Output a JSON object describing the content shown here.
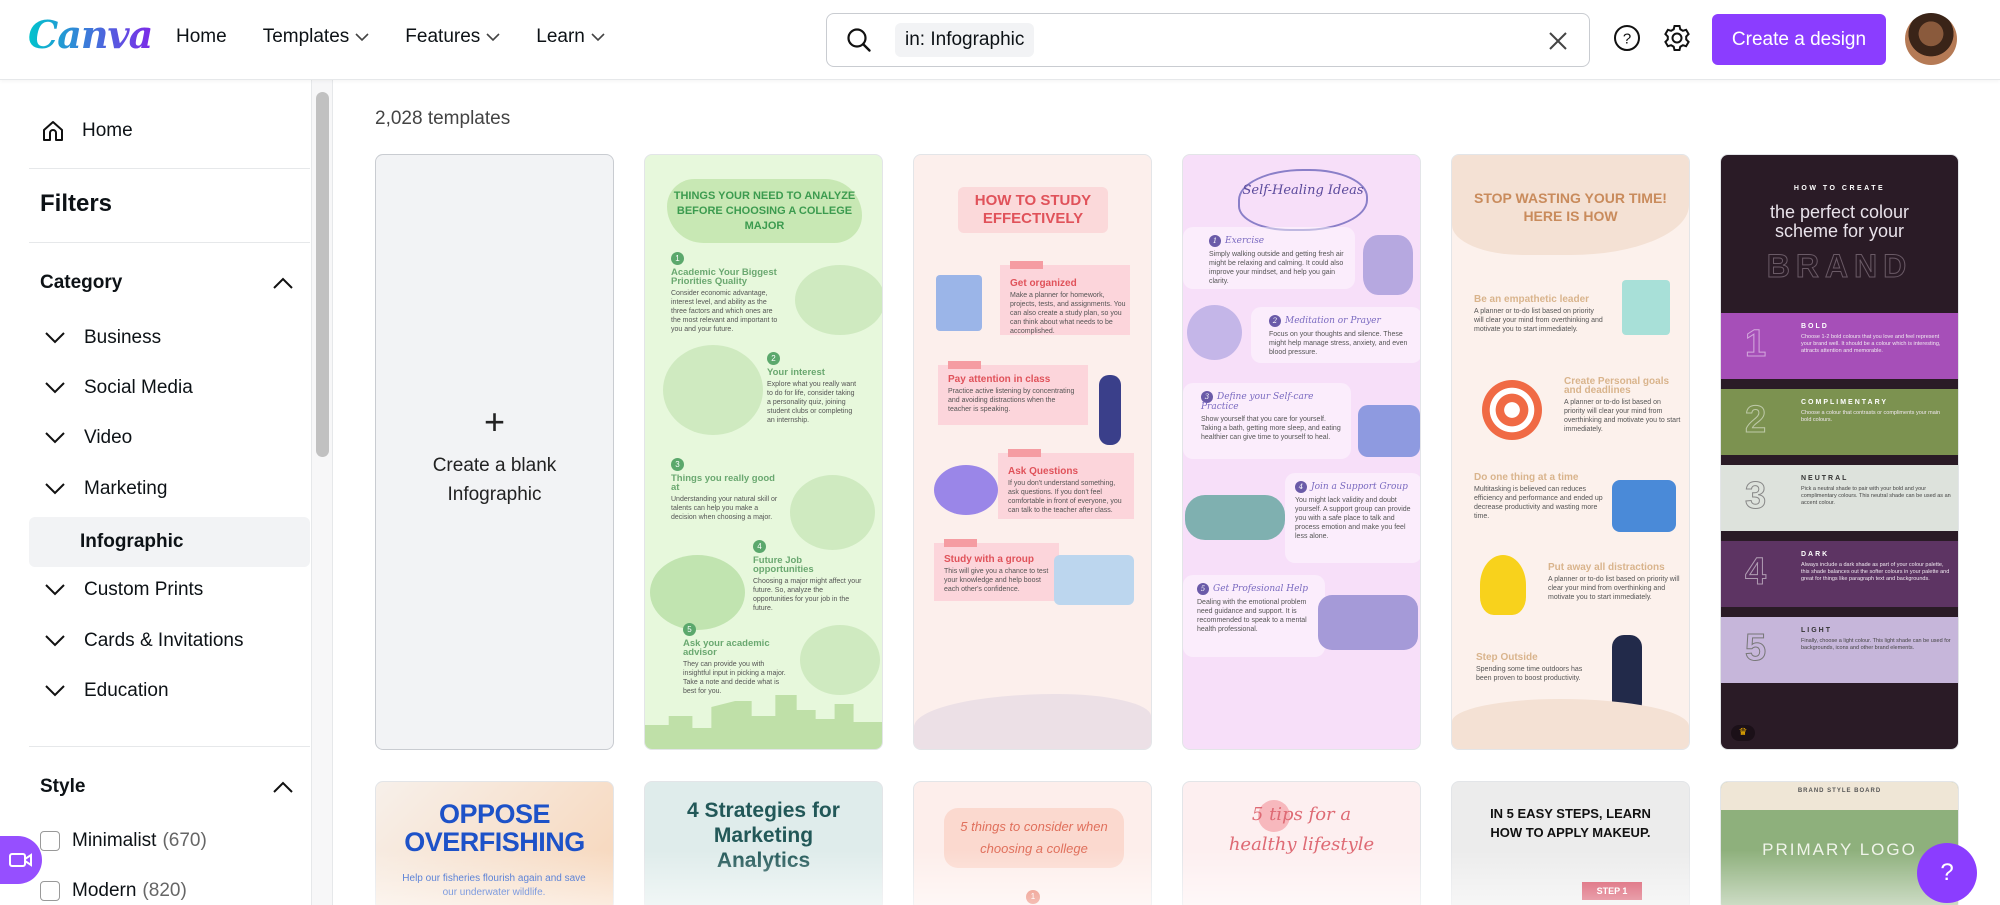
{
  "app": {
    "name": "Canva"
  },
  "header": {
    "logo": "Canva",
    "nav": [
      {
        "label": "Home",
        "has_dropdown": false
      },
      {
        "label": "Templates",
        "has_dropdown": true
      },
      {
        "label": "Features",
        "has_dropdown": true
      },
      {
        "label": "Learn",
        "has_dropdown": true
      }
    ],
    "search": {
      "chip": "in: Infographic",
      "icon": "search-icon",
      "clear_icon": "close-icon"
    },
    "help_icon": "help-circle-icon",
    "settings_icon": "gear-icon",
    "create_button": "Create a design",
    "accent_color": "#8b3dff"
  },
  "sidebar": {
    "home": "Home",
    "filters_title": "Filters",
    "category": {
      "title": "Category",
      "items": [
        {
          "label": "Business",
          "expandable": true
        },
        {
          "label": "Social Media",
          "expandable": true
        },
        {
          "label": "Video",
          "expandable": true
        },
        {
          "label": "Marketing",
          "expandable": true
        },
        {
          "label": "Infographic",
          "expandable": false,
          "selected": true
        },
        {
          "label": "Custom Prints",
          "expandable": true
        },
        {
          "label": "Cards & Invitations",
          "expandable": true
        },
        {
          "label": "Education",
          "expandable": true
        }
      ]
    },
    "style": {
      "title": "Style",
      "options": [
        {
          "label": "Minimalist",
          "count": "(670)",
          "checked": false
        },
        {
          "label": "Modern",
          "count": "(820)",
          "checked": false
        }
      ]
    }
  },
  "main": {
    "count_label": "2,028 templates",
    "blank_card": {
      "plus": "+",
      "label": "Create a blank Infographic"
    },
    "templates_row1": [
      {
        "title": "THINGS YOUR NEED TO ANALYZE BEFORE CHOOSING A COLLEGE MAJOR",
        "sections": [
          {
            "num": "1",
            "heading": "Academic Your Biggest Priorities Quality",
            "body": "Consider economic advantage, interest level, and ability as the three factors and which ones are the most relevant and important to you and your future."
          },
          {
            "num": "2",
            "heading": "Your interest",
            "body": "Explore what you really want to do for life, consider taking a personality quiz, joining student clubs or completing an internship."
          },
          {
            "num": "3",
            "heading": "Things you really good at",
            "body": "Understanding your natural skill or talents can help you make a decision when choosing a major."
          },
          {
            "num": "4",
            "heading": "Future Job opportunities",
            "body": "Choosing a major might affect your future. So, analyze the opportunities for your job in the future."
          },
          {
            "num": "5",
            "heading": "Ask your academic advisor",
            "body": "They can provide you with insightful input in picking a major. Take a note and decide what is best for you."
          }
        ]
      },
      {
        "title": "HOW TO STUDY EFFECTIVELY",
        "sections": [
          {
            "heading": "Get organized",
            "body": "Make a planner for homework, projects, tests, and assignments. You can also create a study plan, so you can think about what needs to be accomplished."
          },
          {
            "heading": "Pay attention in class",
            "body": "Practice active listening by concentrating and avoiding distractions when the teacher is speaking."
          },
          {
            "heading": "Ask Questions",
            "body": "If you don't understand something, ask questions. If you don't feel comfortable in front of everyone, you can talk to the teacher after class."
          },
          {
            "heading": "Study with a group",
            "body": "This will give you a chance to test your knowledge and help boost each other's confidence."
          }
        ]
      },
      {
        "title": "Self-Healing Ideas",
        "sections": [
          {
            "num": "1",
            "heading": "Exercise",
            "body": "Simply walking outside and getting fresh air might be relaxing and calming. It could also improve your mindset, and help you gain clarity."
          },
          {
            "num": "2",
            "heading": "Meditation or Prayer",
            "body": "Focus on your thoughts and silence. These might help manage stress, anxiety, and even blood pressure."
          },
          {
            "num": "3",
            "heading": "Define your Self-care Practice",
            "body": "Show yourself that you care for yourself. Taking a bath, getting more sleep, and eating healthier can give time to yourself to heal."
          },
          {
            "num": "4",
            "heading": "Join a Support Group",
            "body": "You might lack validity and doubt yourself. A support group can provide you with a safe place to talk and process emotion and make you feel less alone."
          },
          {
            "num": "5",
            "heading": "Get Profesional Help",
            "body": "Dealing with the emotional problem need guidance and support. It is recommended to speak to a mental health professional."
          }
        ]
      },
      {
        "title": "STOP WASTING YOUR TIME! HERE IS HOW",
        "sections": [
          {
            "heading": "Be an empathetic leader",
            "body": "A planner or to-do list based on priority will clear your mind from overthinking and motivate you to start immediately."
          },
          {
            "heading": "Create Personal goals and deadlines",
            "body": "A planner or to-do list based on priority will clear your mind from overthinking and motivate you to start immediately."
          },
          {
            "heading": "Do one thing at a time",
            "body": "Multitasking is believed can reduces efficiency and performance and ended up decrease productivity and wasting more time."
          },
          {
            "heading": "Put away all distractions",
            "body": "A planner or to-do list based on priority will clear your mind from overthinking and motivate you to start immediately."
          },
          {
            "heading": "Step Outside",
            "body": "Spending some time outdoors has been proven to boost productivity."
          }
        ]
      },
      {
        "pre_title": "HOW TO CREATE",
        "title": "the perfect colour scheme for your",
        "title_outline": "BRAND",
        "premium_icon": "crown-icon",
        "sections": [
          {
            "num": "1",
            "heading": "BOLD",
            "body": "Choose 1-2 bold colours that you love and feel represent your brand well. It should be a colour which is interesting, attracts attention and memorable.",
            "color": "#a64fb8"
          },
          {
            "num": "2",
            "heading": "COMPLIMENTARY",
            "body": "Choose a colour that contrasts or compliments your main bold colours.",
            "color": "#7c9250"
          },
          {
            "num": "3",
            "heading": "NEUTRAL",
            "body": "Pick a neutral shade to pair with your bold and your complimentary colours. This neutral shade can be used as an accent colour.",
            "color": "#dde2dc"
          },
          {
            "num": "4",
            "heading": "DARK",
            "body": "Always include a dark shade as part of your colour palette, this shade balances out the softer colours in your palette and great for things like paragraph text and backgrounds.",
            "color": "#5d3463"
          },
          {
            "num": "5",
            "heading": "LIGHT",
            "body": "Finally, choose a light colour. This light shade can be used for backgrounds, icons and other brand elements.",
            "color": "#c6b6da"
          }
        ]
      }
    ],
    "templates_row2": [
      {
        "title": "OPPOSE OVERFISHING",
        "subtitle": "Help our fisheries flourish again and save our underwater wildlife."
      },
      {
        "title": "4 Strategies for Marketing Analytics"
      },
      {
        "title": "5 things to consider when choosing a college",
        "badge": "1"
      },
      {
        "title": "5 tips for a healthy lifestyle"
      },
      {
        "title": "IN 5 EASY STEPS, LEARN HOW TO APPLY MAKEUP.",
        "badge": "STEP 1"
      },
      {
        "pre_title": "BRAND STYLE BOARD",
        "title": "PRIMARY LOGO"
      }
    ]
  },
  "fabs": {
    "video": "video-camera-icon",
    "help": "?"
  }
}
